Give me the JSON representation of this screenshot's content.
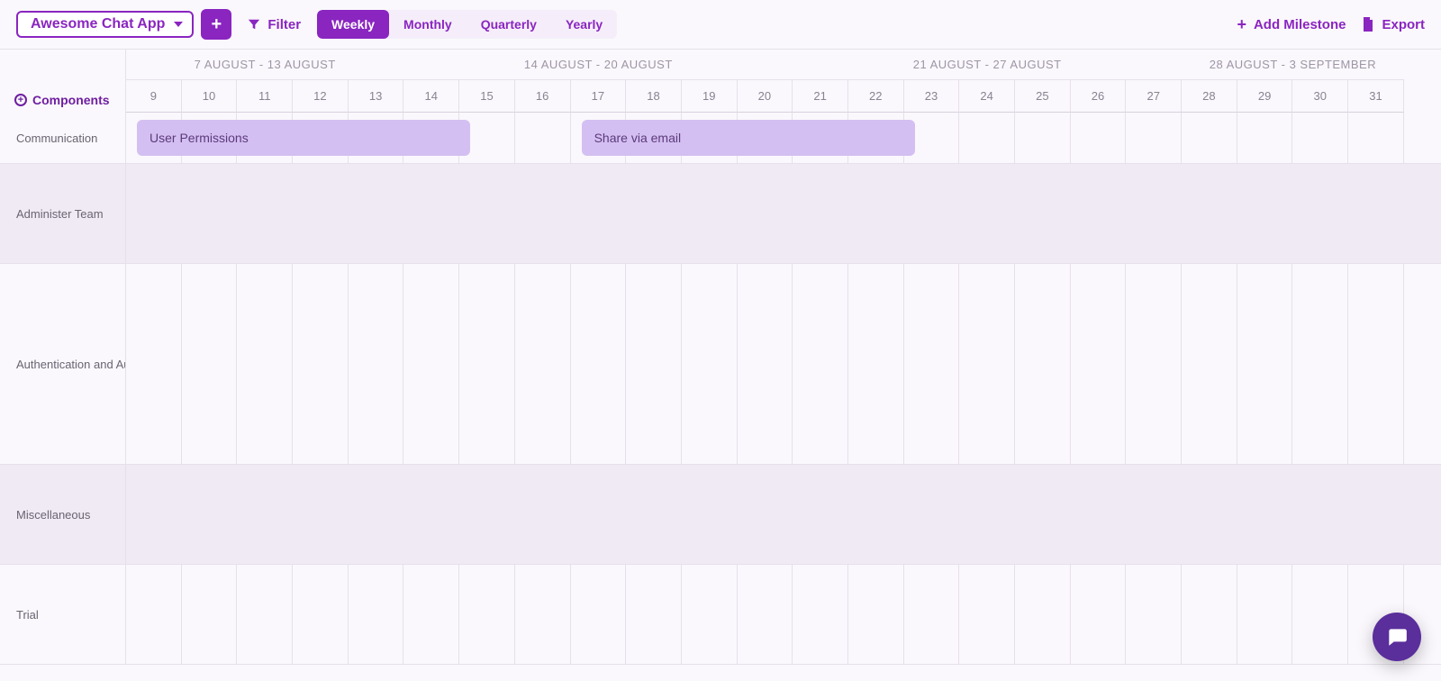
{
  "toolbar": {
    "project_name": "Awesome Chat App",
    "filter_label": "Filter",
    "add_milestone_label": "Add Milestone",
    "export_label": "Export"
  },
  "view_switch": {
    "options": [
      "Weekly",
      "Monthly",
      "Quarterly",
      "Yearly"
    ],
    "active_index": 0
  },
  "side_header": "Components",
  "weeks": [
    {
      "label": "7 AUGUST - 13 AUGUST",
      "span": 5
    },
    {
      "label": "14 AUGUST - 20 AUGUST",
      "span": 7
    },
    {
      "label": "21 AUGUST - 27 AUGUST",
      "span": 7
    },
    {
      "label": "28 AUGUST - 3 SEPTEMBER",
      "span": 4
    }
  ],
  "days": [
    "9",
    "10",
    "11",
    "12",
    "13",
    "14",
    "15",
    "16",
    "17",
    "18",
    "19",
    "20",
    "21",
    "22",
    "23",
    "24",
    "25",
    "26",
    "27",
    "28",
    "29",
    "30",
    "31"
  ],
  "rows": [
    {
      "label": "Communication",
      "height": "sm",
      "shaded": false
    },
    {
      "label": "Administer Team",
      "height": "md",
      "shaded": true
    },
    {
      "label": "Authentication and Au…",
      "height": "lg",
      "shaded": false
    },
    {
      "label": "Miscellaneous",
      "height": "md",
      "shaded": true
    },
    {
      "label": "Trial",
      "height": "md",
      "shaded": false
    }
  ],
  "tasks": [
    {
      "row": 0,
      "label": "User Permissions",
      "start_day_index": 0,
      "span_days": 6
    },
    {
      "row": 0,
      "label": "Share via email",
      "start_day_index": 8,
      "span_days": 6
    }
  ],
  "colors": {
    "accent": "#8a25c0",
    "task_bg": "#d4bff2"
  }
}
